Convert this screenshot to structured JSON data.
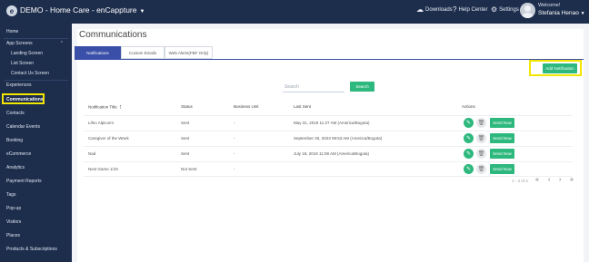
{
  "header": {
    "app_title": "DEMO - Home Care - enCappture",
    "downloads": "Downloads",
    "help_center": "Help Center",
    "settings": "Settings",
    "welcome": "Welcome!",
    "user_name": "Stefania Henao"
  },
  "sidebar": {
    "items": [
      {
        "label": "Home"
      },
      {
        "label": "App Screens"
      },
      {
        "label": "Landing Screen"
      },
      {
        "label": "List Screen"
      },
      {
        "label": "Contact Us Screen"
      },
      {
        "label": "Experiences"
      },
      {
        "label": "Communications"
      },
      {
        "label": "Contacts"
      },
      {
        "label": "Calendar Events"
      },
      {
        "label": "Booking"
      },
      {
        "label": "eCommerce"
      },
      {
        "label": "Analytics"
      },
      {
        "label": "Payment Reports"
      },
      {
        "label": "Tags"
      },
      {
        "label": "Pop-up"
      },
      {
        "label": "Visitors"
      },
      {
        "label": "Places"
      },
      {
        "label": "Products & Subscriptions"
      }
    ]
  },
  "page": {
    "title": "Communications",
    "tabs": [
      {
        "label": "Notifications"
      },
      {
        "label": "Custom Emails"
      },
      {
        "label": "Web Alerts(FBF Only)"
      }
    ],
    "add_button": "Add Notification",
    "search_placeholder": "Search",
    "search_button": "Search"
  },
  "table": {
    "headers": [
      "Notification Title",
      "Status",
      "Business Unit",
      "Last Sent",
      "Actions"
    ],
    "rows": [
      {
        "title": "Lifeo Alpicom!",
        "status": "Sent",
        "unit": "-",
        "last_sent": "May 31, 2019 11:27 AM (America/Bogota)"
      },
      {
        "title": "Caregiver of the Week",
        "status": "Sent",
        "unit": "-",
        "last_sent": "September 26, 2023 08:53 AM (America/Bogota)"
      },
      {
        "title": "Nad",
        "status": "Sent",
        "unit": "-",
        "last_sent": "July 18, 2019 11:08 AM (America/Bogota)"
      },
      {
        "title": "Next Game 1/19",
        "status": "Not Sent",
        "unit": "-",
        "last_sent": ""
      }
    ],
    "send_label": "Send Now",
    "pager_text": "1 - 4 of 4"
  }
}
